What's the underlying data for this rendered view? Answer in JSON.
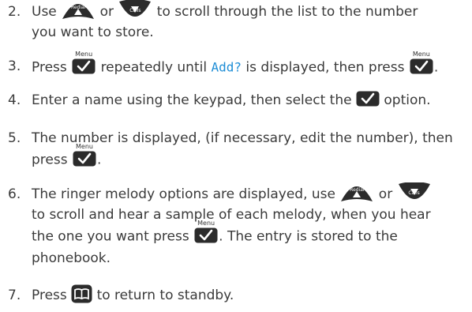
{
  "steps": [
    {
      "num": "2.",
      "line1_a": "Use",
      "line1_b": "or",
      "line1_c": "to scroll through the list to the number",
      "line2": "you want to store."
    },
    {
      "num": "3.",
      "a": "Press",
      "b": "repeatedly until",
      "lcd": "Add?",
      "c": "is displayed, then press",
      "d": "."
    },
    {
      "num": "4.",
      "a": "Enter a name using the keypad, then select the",
      "b": "option."
    },
    {
      "num": "5.",
      "line1": "The number is displayed, (if necessary, edit the number), then",
      "line2_a": "press",
      "line2_b": "."
    },
    {
      "num": "6.",
      "line1_a": "The ringer melody options are displayed, use",
      "line1_b": "or",
      "line2": "to scroll and hear a sample of each melody, when you hear",
      "line3_a": "the one you want press",
      "line3_b": ". The entry is stored to the",
      "line4": "phonebook."
    },
    {
      "num": "7.",
      "a": "Press",
      "b": "to return to standby."
    }
  ],
  "keys": {
    "menu_label": "Menu",
    "redial_label": "Redial",
    "calls_label": "Calls"
  },
  "icons": {
    "menu": "checkmark-icon",
    "up": "redial-up-icon",
    "down": "calls-down-icon",
    "phonebook": "phonebook-icon"
  }
}
